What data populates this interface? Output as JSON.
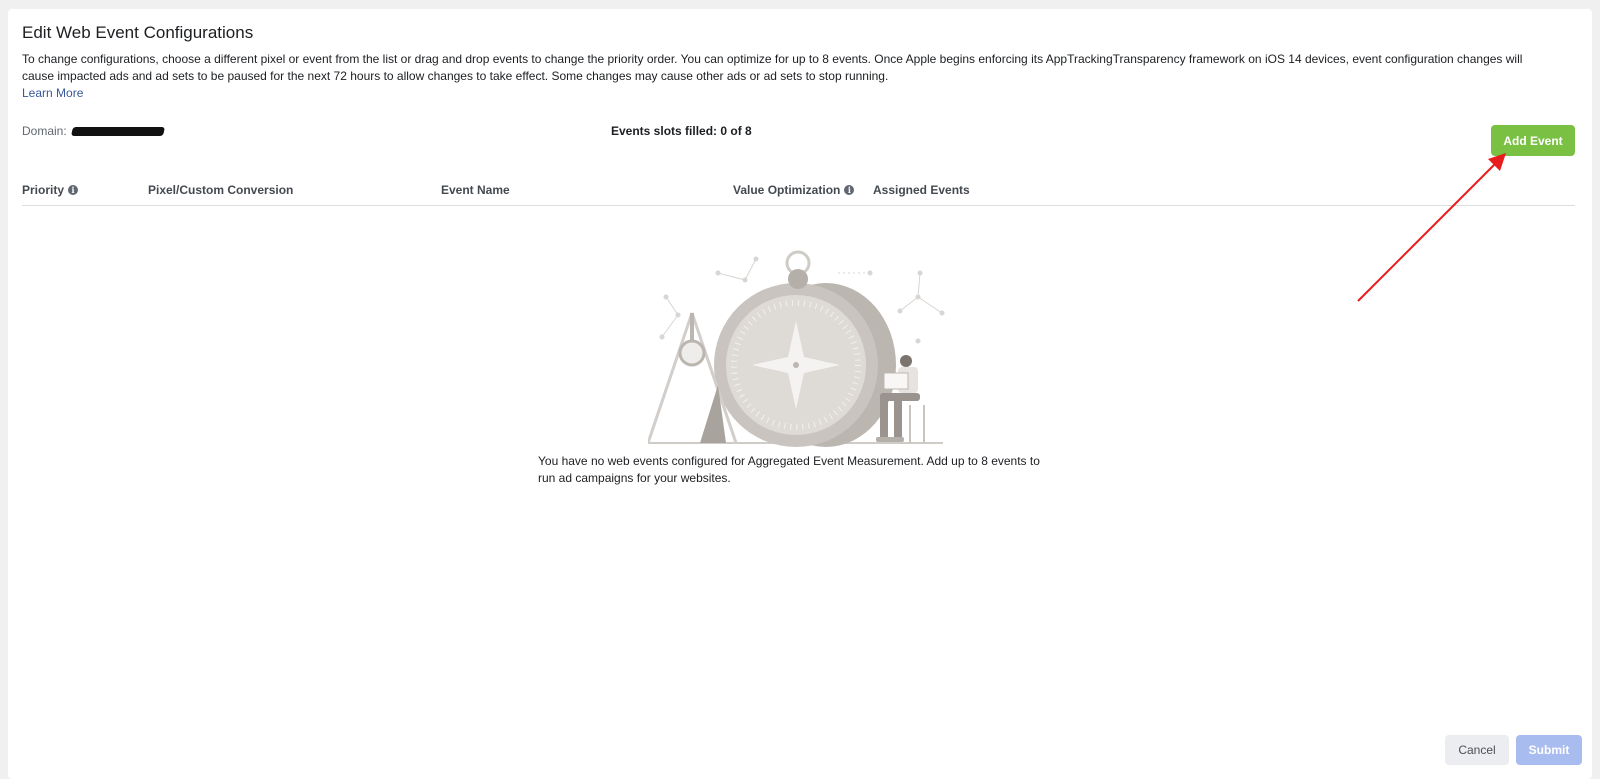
{
  "header": {
    "title": "Edit Web Event Configurations",
    "description": "To change configurations, choose a different pixel or event from the list or drag and drop events to change the priority order. You can optimize for up to 8 events. Once Apple begins enforcing its AppTrackingTransparency framework on iOS 14 devices, event configuration changes will cause impacted ads and ad sets to be paused for the next 72 hours to allow changes to take effect. Some changes may cause other ads or ad sets to stop running.",
    "learn_more": "Learn More"
  },
  "domain": {
    "label": "Domain:"
  },
  "slots": {
    "text": "Events slots filled: 0 of 8"
  },
  "actions": {
    "add_event": "Add Event",
    "cancel": "Cancel",
    "submit": "Submit"
  },
  "table": {
    "columns": [
      {
        "label": "Priority",
        "has_info": true
      },
      {
        "label": "Pixel/Custom Conversion",
        "has_info": false
      },
      {
        "label": "Event Name",
        "has_info": false
      },
      {
        "label": "Value Optimization",
        "has_info": true
      },
      {
        "label": "Assigned Events",
        "has_info": false
      }
    ]
  },
  "empty_state": {
    "message": "You have no web events configured for Aggregated Event Measurement. Add up to 8 events to run ad campaigns for your websites."
  },
  "colors": {
    "add_event_bg": "#7ac143",
    "submit_disabled_bg": "#a8bcef",
    "annotation_arrow": "#e81c1c",
    "link": "#385898"
  },
  "icons": {
    "info": "info-icon",
    "illustration": "compass-illustration-icon",
    "annotation": "red-arrow-annotation"
  }
}
